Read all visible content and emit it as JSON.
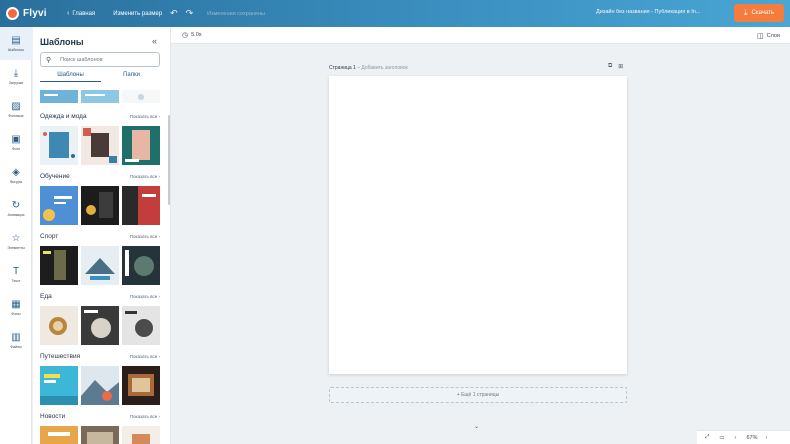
{
  "header": {
    "logo_text": "Flyvi",
    "nav_back_label": "Главная",
    "nav_resize_label": "Изменить размер",
    "undo_icon": "undo-icon",
    "status_text": "Изменения сохранены",
    "document_title": "Дизайн без названия - Публикация в In...",
    "save_label": "Скачать",
    "save_color": "#f47c3c"
  },
  "rail": {
    "items": [
      {
        "label": "Шаблоны",
        "icon": "templates-icon",
        "glyph": "▤"
      },
      {
        "label": "Загрузки",
        "icon": "upload-icon",
        "glyph": "⤓"
      },
      {
        "label": "Фоновые",
        "icon": "background-icon",
        "glyph": "▨"
      },
      {
        "label": "Фото",
        "icon": "photo-icon",
        "glyph": "▣"
      },
      {
        "label": "Фигуры",
        "icon": "shapes-icon",
        "glyph": "◈"
      },
      {
        "label": "Анимация",
        "icon": "animation-icon",
        "glyph": "↻"
      },
      {
        "label": "Элементы",
        "icon": "elements-icon",
        "glyph": "☆"
      },
      {
        "label": "Текст",
        "icon": "text-icon",
        "glyph": "T"
      },
      {
        "label": "Фоны",
        "icon": "patterns-icon",
        "glyph": "▦"
      },
      {
        "label": "Файлы",
        "icon": "files-icon",
        "glyph": "▥"
      }
    ]
  },
  "panel": {
    "title": "Шаблоны",
    "search_placeholder": "Поиск шаблонов",
    "tabs": [
      "Шаблоны",
      "Папки"
    ],
    "show_all_label": "Показать все",
    "categories": [
      {
        "name": "Одежда и мода"
      },
      {
        "name": "Обучение"
      },
      {
        "name": "Спорт"
      },
      {
        "name": "Еда"
      },
      {
        "name": "Путешествия"
      },
      {
        "name": "Новости"
      }
    ]
  },
  "canvas": {
    "duration": "5.0s",
    "layers_label": "Слои",
    "page_label": "Страница 1",
    "page_title_placeholder": "Добавить заголовок",
    "add_page_label": "+ Ещё 1 страницы",
    "zoom": "67%"
  }
}
